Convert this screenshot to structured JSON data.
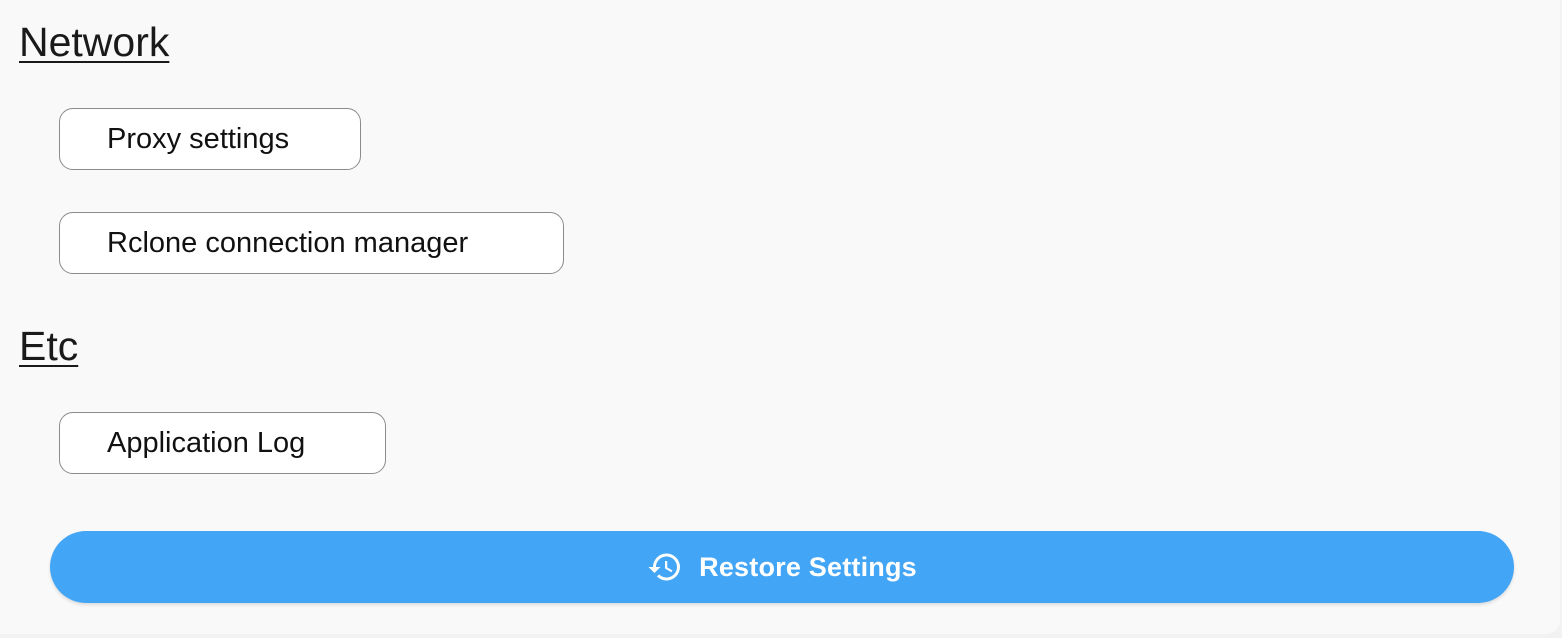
{
  "sections": {
    "network": {
      "title": "Network",
      "buttons": {
        "proxy": "Proxy settings",
        "rclone": "Rclone connection manager"
      }
    },
    "etc": {
      "title": "Etc",
      "buttons": {
        "log": "Application Log"
      }
    }
  },
  "restore": {
    "label": "Restore Settings",
    "icon": "restore-history-icon"
  },
  "colors": {
    "accent": "#42a5f5",
    "background": "#f9f9f9"
  }
}
